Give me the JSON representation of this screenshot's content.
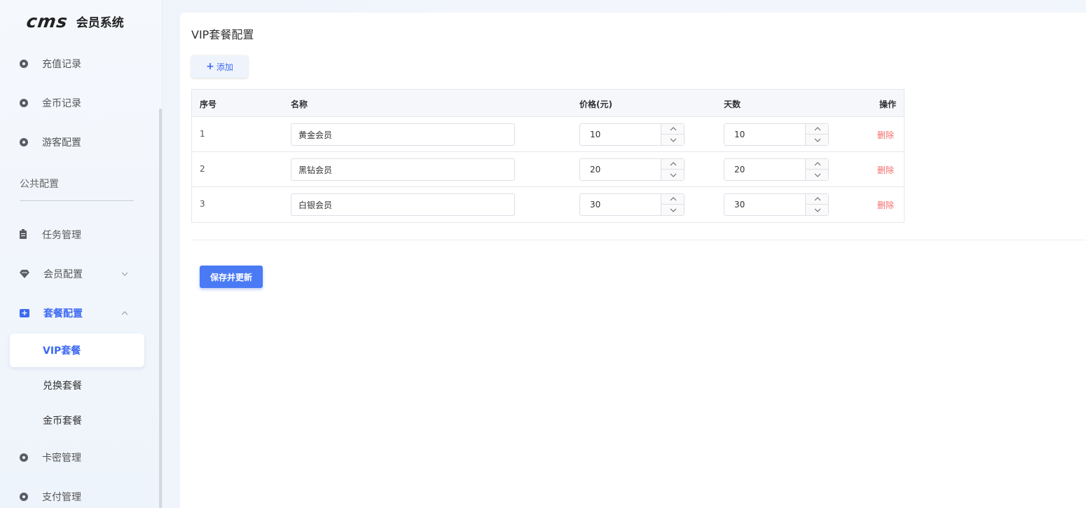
{
  "app": {
    "logo_mark": "cms",
    "name": "会员系统"
  },
  "sidebar": {
    "items_top": [
      {
        "label": "充值记录",
        "icon": "circle-dot-icon"
      },
      {
        "label": "金币记录",
        "icon": "circle-dot-icon"
      },
      {
        "label": "游客配置",
        "icon": "circle-dot-icon"
      }
    ],
    "section_label": "公共配置",
    "task": {
      "label": "任务管理",
      "icon": "clipboard-icon"
    },
    "member": {
      "label": "会员配置",
      "icon": "gem-icon"
    },
    "package": {
      "label": "套餐配置",
      "icon": "plus-square-icon"
    },
    "sub_items": [
      {
        "label": "VIP套餐",
        "active": true
      },
      {
        "label": "兑换套餐",
        "active": false
      },
      {
        "label": "金币套餐",
        "active": false
      }
    ],
    "card": {
      "label": "卡密管理",
      "icon": "circle-dot-icon"
    },
    "pay": {
      "label": "支付管理",
      "icon": "circle-dot-icon"
    }
  },
  "main": {
    "title": "VIP套餐配置",
    "add_label": "添加",
    "table": {
      "headers": {
        "index": "序号",
        "name": "名称",
        "price": "价格(元)",
        "days": "天数",
        "ops": "操作"
      },
      "rows": [
        {
          "index": "1",
          "name": "黄金会员",
          "price": "10",
          "days": "10",
          "delete": "删除"
        },
        {
          "index": "2",
          "name": "黑钻会员",
          "price": "20",
          "days": "20",
          "delete": "删除"
        },
        {
          "index": "3",
          "name": "白银会员",
          "price": "30",
          "days": "30",
          "delete": "删除"
        }
      ]
    },
    "save_label": "保存并更新"
  },
  "colors": {
    "accent": "#3d6af2",
    "danger": "#f56c6c",
    "save_button": "#4a7af4"
  }
}
